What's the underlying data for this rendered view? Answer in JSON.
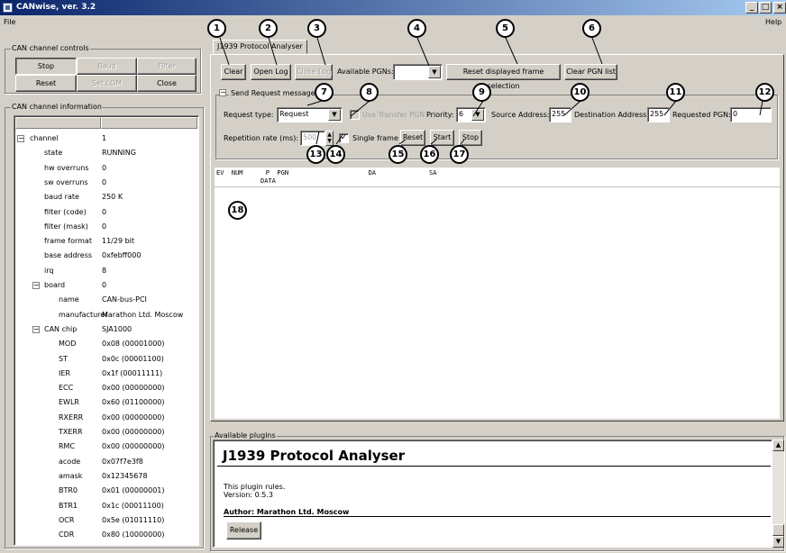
{
  "window": {
    "title": "CANwise, ver. 3.2",
    "minimize": "_",
    "maximize": "□",
    "close": "×"
  },
  "menu": {
    "file": "File",
    "help": "Help"
  },
  "controls": {
    "title": "CAN channel controls",
    "stop": "Stop",
    "baud": "Baud",
    "filter": "Filter",
    "reset": "Reset",
    "set_lom": "Set LOM",
    "close": "Close"
  },
  "info": {
    "title": "CAN channel information",
    "rows": [
      {
        "key": "channel",
        "value": "1",
        "level": 0,
        "expand": "−"
      },
      {
        "key": "state",
        "value": "RUNNING",
        "level": 1
      },
      {
        "key": "hw overruns",
        "value": "0",
        "level": 1
      },
      {
        "key": "sw overruns",
        "value": "0",
        "level": 1
      },
      {
        "key": "baud rate",
        "value": "250 K",
        "level": 1
      },
      {
        "key": "filter (code)",
        "value": "0",
        "level": 1
      },
      {
        "key": "filter (mask)",
        "value": "0",
        "level": 1
      },
      {
        "key": "frame format",
        "value": "11/29 bit",
        "level": 1
      },
      {
        "key": "base address",
        "value": "0xfebff000",
        "level": 1
      },
      {
        "key": "irq",
        "value": "8",
        "level": 1
      },
      {
        "key": "board",
        "value": "0",
        "level": 1,
        "expand": "−"
      },
      {
        "key": "name",
        "value": "CAN-bus-PCI",
        "level": 2
      },
      {
        "key": "manufacturer",
        "value": "Marathon Ltd. Moscow",
        "level": 2
      },
      {
        "key": "CAN chip",
        "value": "SJA1000",
        "level": 1,
        "expand": "−"
      },
      {
        "key": "MOD",
        "value": "0x08 (00001000)",
        "level": 2
      },
      {
        "key": "ST",
        "value": "0x0c (00001100)",
        "level": 2
      },
      {
        "key": "IER",
        "value": "0x1f (00011111)",
        "level": 2
      },
      {
        "key": "ECC",
        "value": "0x00 (00000000)",
        "level": 2
      },
      {
        "key": "EWLR",
        "value": "0x60 (01100000)",
        "level": 2
      },
      {
        "key": "RXERR",
        "value": "0x00 (00000000)",
        "level": 2
      },
      {
        "key": "TXERR",
        "value": "0x00 (00000000)",
        "level": 2
      },
      {
        "key": "RMC",
        "value": "0x00 (00000000)",
        "level": 2
      },
      {
        "key": "acode",
        "value": "0x07f7e3f8",
        "level": 2
      },
      {
        "key": "amask",
        "value": "0x12345678",
        "level": 2
      },
      {
        "key": "BTR0",
        "value": "0x01 (00000001)",
        "level": 2
      },
      {
        "key": "BTR1",
        "value": "0x1c (00011100)",
        "level": 2
      },
      {
        "key": "OCR",
        "value": "0x5e (01011110)",
        "level": 2
      },
      {
        "key": "CDR",
        "value": "0x80 (10000000)",
        "level": 2
      }
    ]
  },
  "analyser": {
    "tab": "J1939 Protocol Analyser",
    "clear": "Clear",
    "open_log": "Open Log",
    "close_log": "Close Log",
    "available_pgns_label": "Available PGNs:",
    "available_pgns_value": "",
    "reset_selection": "Reset displayed frame selection",
    "clear_pgn": "Clear PGN list",
    "send_request": "Send Request message",
    "send_request_toggle": "−",
    "request_type_label": "Request type:",
    "request_type": "Request",
    "use_transfer_pgn": "Use Transfer PGN",
    "priority_label": "Priority:",
    "priority": "6",
    "source_label": "Source Address:",
    "source": "255",
    "dest_label": "Destination Address:",
    "dest": "255",
    "req_pgn_label": "Requested PGN:",
    "req_pgn": "0",
    "rep_rate_label": "Repetition rate (ms):",
    "rep_rate": "500",
    "single_frame": "Single frame",
    "single_frame_check": "✓",
    "reset": "Reset",
    "start": "Start",
    "stop": "Stop",
    "log_header1": "EV  NUM      P  PGN                     DA              SA",
    "log_header2": "DATA"
  },
  "callouts": [
    "1",
    "2",
    "3",
    "4",
    "5",
    "6",
    "7",
    "8",
    "9",
    "10",
    "11",
    "12",
    "13",
    "14",
    "15",
    "16",
    "17",
    "18"
  ],
  "plugins": {
    "title": "Available plugins",
    "heading": "J1939 Protocol Analyser",
    "desc": "This plugin rules.",
    "version": "Version: 0.5.3",
    "author": "Author: Marathon Ltd. Moscow",
    "release": "Release"
  }
}
